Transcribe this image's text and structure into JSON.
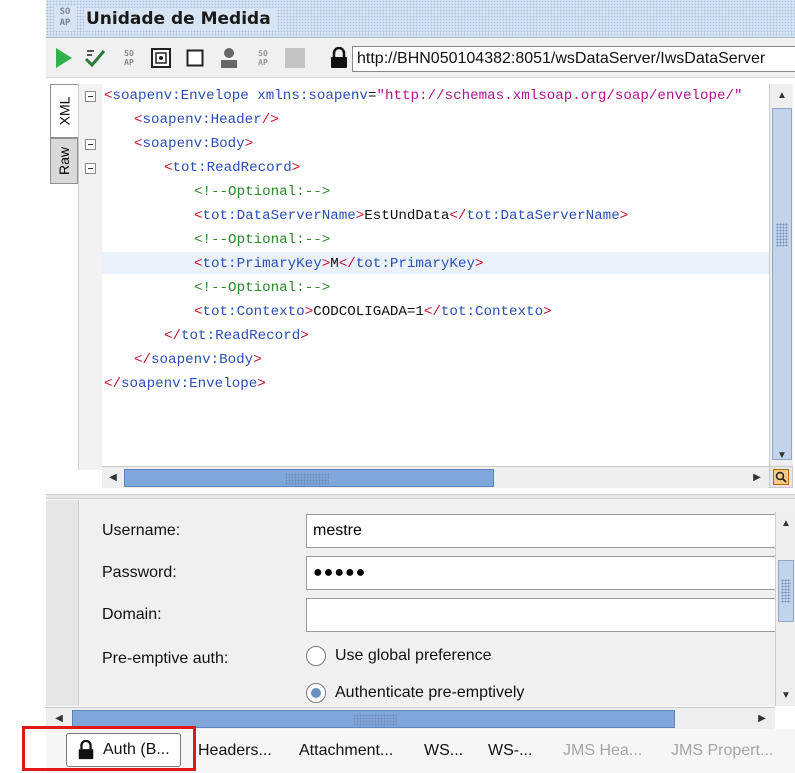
{
  "window": {
    "title": "Unidade de Medida",
    "soap_logo": [
      "SO",
      "AP"
    ]
  },
  "toolbar": {
    "url": "http://BHN050104382:8051/wsDataServer/IwsDataServer",
    "icons": [
      "run-icon",
      "check-icon",
      "soap-icon",
      "format-icon",
      "stop-icon",
      "user-icon",
      "soap-icon",
      "disabled-icon",
      "lock-icon"
    ]
  },
  "editor": {
    "tabs": [
      "XML",
      "Raw"
    ],
    "lines": [
      {
        "indent": 0,
        "tokens": [
          [
            "tag",
            "<"
          ],
          [
            "tname",
            "soapenv:Envelope"
          ],
          [
            "txt",
            " "
          ],
          [
            "attr",
            "xmlns:soapenv"
          ],
          [
            "txt",
            "="
          ],
          [
            "aval",
            "\"http://schemas.xmlsoap.org/soap/envelope/\""
          ]
        ]
      },
      {
        "indent": 1,
        "tokens": [
          [
            "tag",
            "<"
          ],
          [
            "tname",
            "soapenv:Header"
          ],
          [
            "tag",
            "/>"
          ]
        ]
      },
      {
        "indent": 1,
        "tokens": [
          [
            "tag",
            "<"
          ],
          [
            "tname",
            "soapenv:Body"
          ],
          [
            "tag",
            ">"
          ]
        ]
      },
      {
        "indent": 2,
        "tokens": [
          [
            "tag",
            "<"
          ],
          [
            "tname",
            "tot:ReadRecord"
          ],
          [
            "tag",
            ">"
          ]
        ]
      },
      {
        "indent": 3,
        "tokens": [
          [
            "cmt",
            "<!--Optional:-->"
          ]
        ]
      },
      {
        "indent": 3,
        "tokens": [
          [
            "tag",
            "<"
          ],
          [
            "tname",
            "tot:DataServerName"
          ],
          [
            "tag",
            ">"
          ],
          [
            "txt",
            "EstUndData"
          ],
          [
            "tag",
            "</"
          ],
          [
            "tname",
            "tot:DataServerName"
          ],
          [
            "tag",
            ">"
          ]
        ]
      },
      {
        "indent": 3,
        "tokens": [
          [
            "cmt",
            "<!--Optional:-->"
          ]
        ]
      },
      {
        "indent": 3,
        "tokens": [
          [
            "tag",
            "<"
          ],
          [
            "tname",
            "tot:PrimaryKey"
          ],
          [
            "tag",
            ">"
          ],
          [
            "txt",
            "M"
          ],
          [
            "tag",
            "</"
          ],
          [
            "tname",
            "tot:PrimaryKey"
          ],
          [
            "tag",
            ">"
          ]
        ]
      },
      {
        "indent": 3,
        "tokens": [
          [
            "cmt",
            "<!--Optional:-->"
          ]
        ]
      },
      {
        "indent": 3,
        "tokens": [
          [
            "tag",
            "<"
          ],
          [
            "tname",
            "tot:Contexto"
          ],
          [
            "tag",
            ">"
          ],
          [
            "txt",
            "CODCOLIGADA=1"
          ],
          [
            "tag",
            "</"
          ],
          [
            "tname",
            "tot:Contexto"
          ],
          [
            "tag",
            ">"
          ]
        ]
      },
      {
        "indent": 2,
        "tokens": [
          [
            "tag",
            "</"
          ],
          [
            "tname",
            "tot:ReadRecord"
          ],
          [
            "tag",
            ">"
          ]
        ]
      },
      {
        "indent": 1,
        "tokens": [
          [
            "tag",
            "</"
          ],
          [
            "tname",
            "soapenv:Body"
          ],
          [
            "tag",
            ">"
          ]
        ]
      },
      {
        "indent": 0,
        "tokens": [
          [
            "tag",
            "</"
          ],
          [
            "tname",
            "soapenv:Envelope"
          ],
          [
            "tag",
            ">"
          ]
        ]
      }
    ]
  },
  "auth": {
    "username_label": "Username:",
    "username_value": "mestre",
    "password_label": "Password:",
    "password_value": "●●●●●",
    "domain_label": "Domain:",
    "domain_value": "",
    "preemptive_label": "Pre-emptive auth:",
    "option_global": "Use global preference",
    "option_preemptive": "Authenticate pre-emptively",
    "selected_option": "option_preemptive"
  },
  "bottom_tabs": {
    "auth": "Auth (B...",
    "headers": "Headers...",
    "attachments": "Attachment...",
    "ws1": "WS...",
    "ws2": "WS-...",
    "jms_headers": "JMS Hea...",
    "jms_properties": "JMS Propert..."
  },
  "colors": {
    "highlight_box": "#e01818",
    "scroll_thumb": "#7fa7d9"
  }
}
